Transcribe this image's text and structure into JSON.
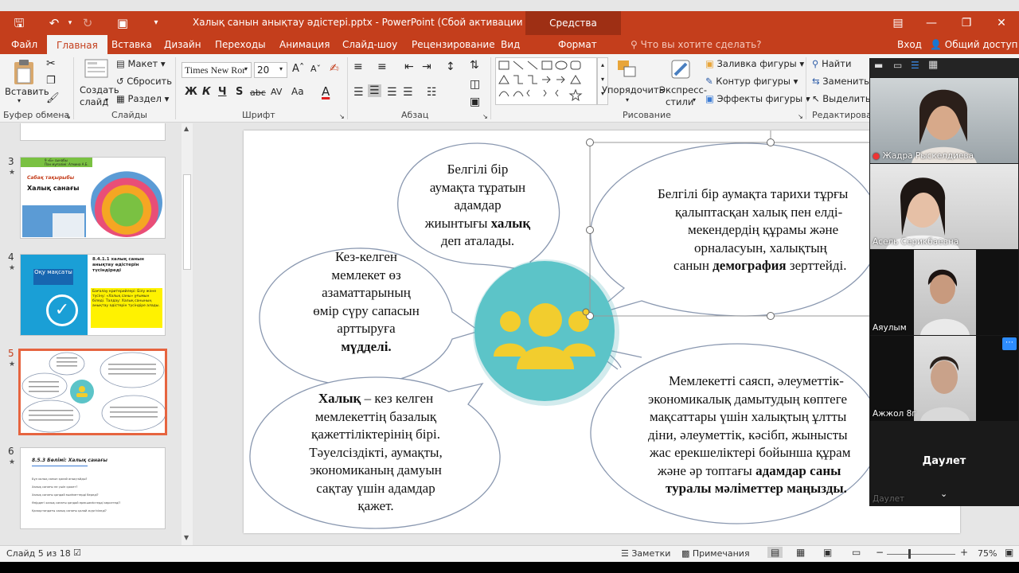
{
  "window": {
    "title": "Халық санын анықтау әдістері.pptx - PowerPoint (Сбой активации продукта)",
    "context_tab": "Средства рисования"
  },
  "tabs": [
    "Файл",
    "Главная",
    "Вставка",
    "Дизайн",
    "Переходы",
    "Анимация",
    "Слайд-шоу",
    "Рецензирование",
    "Вид",
    "Формат"
  ],
  "tell_me": "Что вы хотите сделать?",
  "account": {
    "signin": "Вход",
    "share": "Общий доступ"
  },
  "ribbon": {
    "clipboard": {
      "paste": "Вставить",
      "label": "Буфер обмена"
    },
    "slides": {
      "new_slide_1": "Создать",
      "new_slide_2": "слайд",
      "layout": "Макет",
      "reset": "Сбросить",
      "section": "Раздел",
      "label": "Слайды"
    },
    "font": {
      "family": "Times New Ror",
      "size": "20",
      "label": "Шрифт",
      "bold": "Ж",
      "italic": "К",
      "underline": "Ч",
      "shadow": "S",
      "strike": "abc",
      "spacing": "AV",
      "case": "Aa",
      "color": "A"
    },
    "paragraph": {
      "label": "Абзац"
    },
    "drawing": {
      "arrange_1": "Упорядочить",
      "express_1": "Экспресс-",
      "express_2": "стили",
      "fill": "Заливка фигуры",
      "outline": "Контур фигуры",
      "effects": "Эффекты фигуры",
      "label": "Рисование"
    },
    "editing": {
      "find": "Найти",
      "replace": "Заменить",
      "select": "Выделить",
      "label": "Редактирован"
    }
  },
  "thumbnails": [
    {
      "num": "3",
      "title_line": "Халық санағы",
      "top_line_1": "9 «Б» сынабы",
      "top_line_2": "Пән мұғалімі: Агмина А.Б.",
      "subtitle": "Сабақ тақырыбы"
    },
    {
      "num": "4",
      "heading": "8.4.1.1 халық санын анықтау әдістерін түсіндіреді",
      "badge": "Оқу мақсаты",
      "criteria": "Бағалау критерийлері: Білу және түсіну: «Халық саны» ұғымын біледі. Талдау: Халық санының анықтау әдістерін түсіндіре алады."
    },
    {
      "num": "5"
    },
    {
      "num": "6",
      "heading": "8.5.3 Бөлімі: Халық санағы",
      "lines": [
        "Бұл халық санын қалай анықтайды?",
        "Халық санағы не үшін қажет?",
        "Халық санағы қандай мәліметтерді береді?",
        "Өңірдегі халық санағы қандай ерекшеліктерді көрсетеді?",
        "Қазақстандағы халық санағы қалай жүргізіледі?"
      ]
    }
  ],
  "slide": {
    "bubble_top": [
      "Белгілі бір",
      "аумақта тұратын",
      "адамдар"
    ],
    "bubble_top_l4": "жиынтығы",
    "bubble_top_l4_bold": "халық",
    "bubble_top_l5": "деп аталады.",
    "bubble_left": [
      "Кез-келген",
      "мемлекет өз",
      "азаматтарының",
      "өмір сүру сапасын",
      "арттыруға"
    ],
    "bubble_left_bold": "мүдделі.",
    "bubble_right_top": [
      "Белгілі бір аумақта тарихи тұрғы",
      "қалыптасқан халық пен елді-",
      "мекендердің құрамы және",
      "орналасуын,  халықтың"
    ],
    "bubble_right_top_l5": "санын",
    "bubble_right_top_l5_bold": "демография",
    "bubble_right_top_l5_end": "зерттейді.",
    "bubble_bottom_left_bold": "Халық",
    "bubble_bottom_left_l1": "– кез келген",
    "bubble_bottom_left": [
      "мемлекеттің базалық",
      "қажеттіліктерінің бірі.",
      "Тәуелсіздікті, аумақты,",
      "экономиканың дамуын",
      "сақтау үшін адамдар",
      "қажет."
    ],
    "bubble_bottom_right": [
      "Мемлекетті саясп, әлеуметтік-",
      "экономикалық дамытудың көптеге",
      "мақсаттары үшін халықтың ұлтты",
      "діни, әлеуметтік, кәсібп, жынысты",
      "жас ерекшеліктері бойынша құрам"
    ],
    "bubble_bottom_right_l6": "және әр топтағы",
    "bubble_bottom_right_l6_bold": "адамдар саны",
    "bubble_bottom_right_l7_bold": "туралы мәліметтер маңызды."
  },
  "status": {
    "slide_of": "Слайд 5 из 18",
    "notes": "Заметки",
    "comments": "Примечания",
    "zoom": "75%"
  },
  "participants": [
    {
      "name": "Жадра Рыскелдиева"
    },
    {
      "name": "Асель Серикбаевна"
    },
    {
      "name": "Аяулым"
    },
    {
      "name": "Ажжол 8г"
    },
    {
      "name": "Даулет",
      "sub": "Даулет"
    }
  ],
  "colors": {
    "accent": "#c43e1c",
    "center_circle": "#5cc4c8",
    "people": "#f2cd2e",
    "bubble_border": "#8a98b0"
  }
}
